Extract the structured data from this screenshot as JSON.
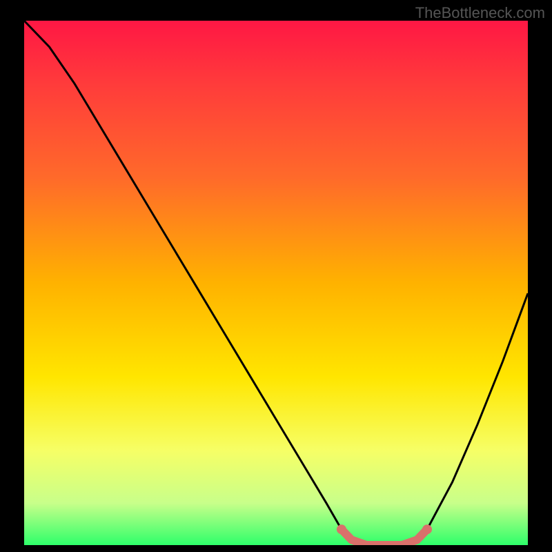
{
  "watermark": "TheBottleneck.com",
  "chart_data": {
    "type": "line",
    "title": "",
    "xlabel": "",
    "ylabel": "",
    "xlim": [
      0,
      100
    ],
    "ylim": [
      0,
      100
    ],
    "curve": {
      "name": "bottleneck-curve",
      "x": [
        0,
        5,
        10,
        15,
        20,
        25,
        30,
        35,
        40,
        45,
        50,
        55,
        60,
        63,
        65,
        68,
        70,
        72,
        75,
        78,
        80,
        85,
        90,
        95,
        100
      ],
      "y": [
        100,
        95,
        88,
        80,
        72,
        64,
        56,
        48,
        40,
        32,
        24,
        16,
        8,
        3,
        1,
        0,
        0,
        0,
        0,
        1,
        3,
        12,
        23,
        35,
        48
      ]
    },
    "highlight_segment": {
      "name": "optimal-range",
      "x": [
        63,
        65,
        68,
        70,
        72,
        75,
        78,
        80
      ],
      "y": [
        3,
        1,
        0,
        0,
        0,
        0,
        1,
        3
      ]
    },
    "gradient_stops": [
      {
        "offset": 0.0,
        "color": "#ff1744"
      },
      {
        "offset": 0.12,
        "color": "#ff3b3b"
      },
      {
        "offset": 0.3,
        "color": "#ff6a2a"
      },
      {
        "offset": 0.5,
        "color": "#ffb200"
      },
      {
        "offset": 0.68,
        "color": "#ffe600"
      },
      {
        "offset": 0.82,
        "color": "#f6ff66"
      },
      {
        "offset": 0.92,
        "color": "#c8ff8a"
      },
      {
        "offset": 1.0,
        "color": "#2eff6a"
      }
    ],
    "colors": {
      "curve": "#000000",
      "highlight": "#d9716b",
      "background": "#000000"
    }
  }
}
